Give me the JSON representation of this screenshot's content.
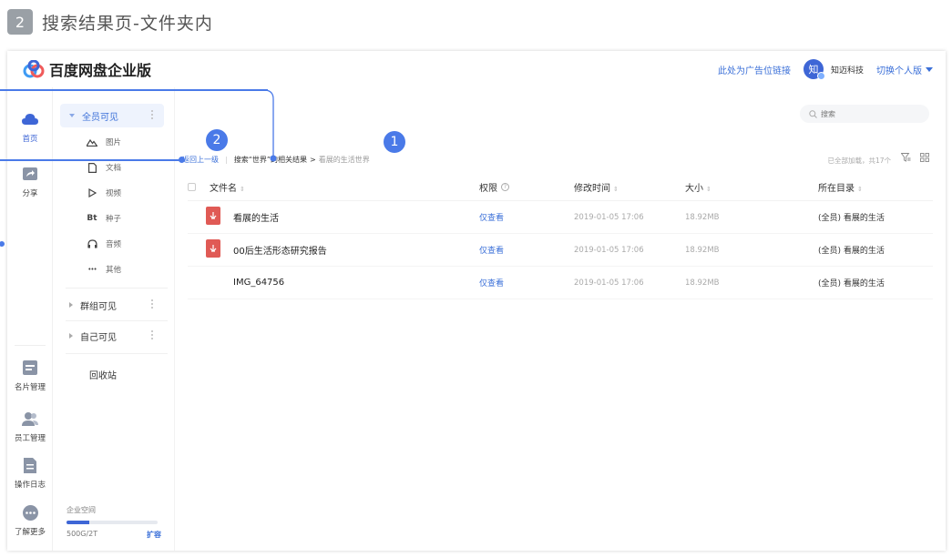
{
  "page": {
    "step": "2",
    "heading": "搜索结果页-文件夹内"
  },
  "topbar": {
    "logo_text": "百度网盘企业版",
    "ad_link": "此处为广告位链接",
    "avatar_char": "知",
    "company": "知迈科技",
    "switch_label": "切换个人版"
  },
  "rail": [
    {
      "name": "首页",
      "icon": "cloud-icon"
    },
    {
      "name": "分享",
      "icon": "share-icon"
    },
    {
      "name": "名片管理",
      "icon": "card-icon"
    },
    {
      "name": "员工管理",
      "icon": "staff-icon"
    },
    {
      "name": "操作日志",
      "icon": "log-icon"
    },
    {
      "name": "了解更多",
      "icon": "more-icon"
    }
  ],
  "tree": {
    "all_visible": "全员可见",
    "sub_items": [
      {
        "label": "图片",
        "icon": "mountain-icon"
      },
      {
        "label": "文档",
        "icon": "doc-icon"
      },
      {
        "label": "视频",
        "icon": "play-icon"
      },
      {
        "label": "种子",
        "icon": "bt-icon"
      },
      {
        "label": "音频",
        "icon": "headphone-icon"
      },
      {
        "label": "其他",
        "icon": "dots-icon"
      }
    ],
    "bt_glyph": "Bt",
    "dots_glyph": "•••",
    "group_visible": "群组可见",
    "self_visible": "自己可见",
    "recycle": "回收站"
  },
  "storage": {
    "title": "企业空间",
    "used": "500G/2T",
    "expand": "扩容",
    "fraction": 0.25
  },
  "main": {
    "search_placeholder": "搜索",
    "back": "返回上一级",
    "crumb_result": "搜索“世界”的相关结果",
    "crumb_sep": ">",
    "crumb_current": "看展的生活世界",
    "status": "已全部加载，共17个",
    "columns": {
      "name": "文件名",
      "perm": "权限",
      "mtime": "修改时间",
      "size": "大小",
      "dir": "所在目录"
    },
    "rows": [
      {
        "name": "看展的生活",
        "type": "pdf",
        "perm": "仅查看",
        "mtime": "2019-01-05 17:06",
        "size": "18.92MB",
        "dir": "(全员) 看展的生活"
      },
      {
        "name": "00后生活形态研究报告",
        "type": "pdf",
        "perm": "仅查看",
        "mtime": "2019-01-05 17:06",
        "size": "18.92MB",
        "dir": "(全员) 看展的生活"
      },
      {
        "name": "IMG_64756",
        "type": "image",
        "perm": "仅查看",
        "mtime": "2019-01-05 17:06",
        "size": "18.92MB",
        "dir": "(全员) 看展的生活"
      }
    ]
  },
  "annotations": {
    "one": "1",
    "two": "2"
  },
  "colors": {
    "accent": "#3e66d6",
    "link": "#3a6fd8",
    "pdf": "#e05a55",
    "annotation": "#4a7ae8"
  }
}
